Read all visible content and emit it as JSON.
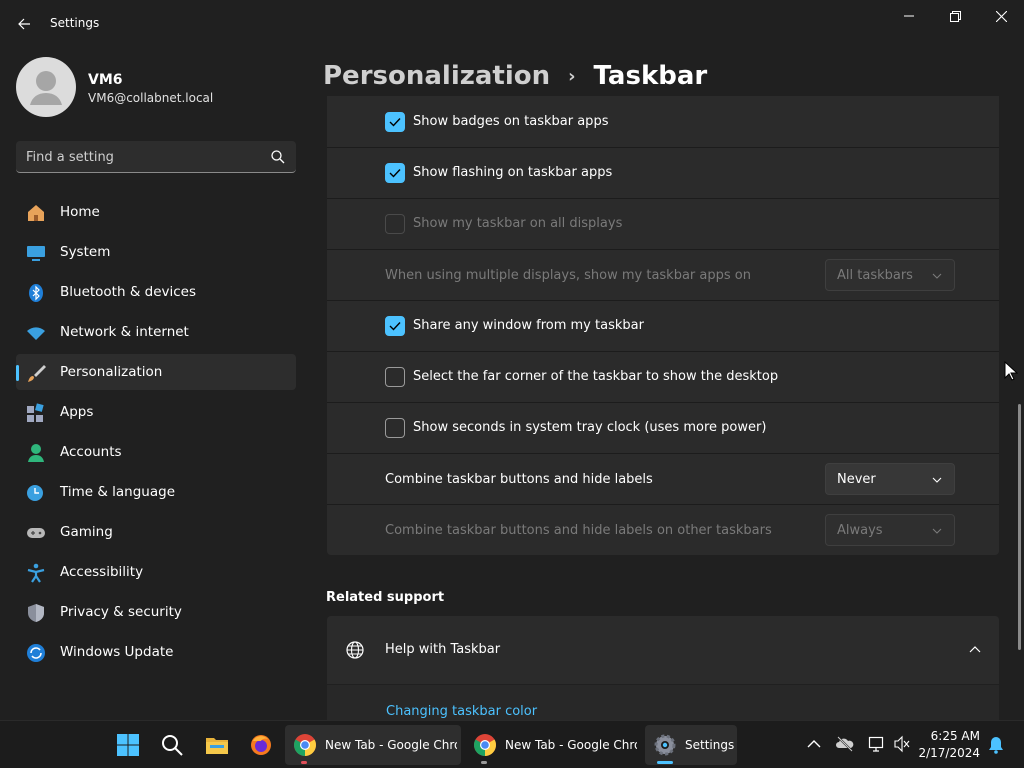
{
  "window": {
    "title": "Settings",
    "controls": [
      "minimize",
      "restore",
      "close"
    ]
  },
  "user": {
    "name": "VM6",
    "email": "VM6@collabnet.local"
  },
  "search": {
    "placeholder": "Find a setting"
  },
  "nav": {
    "items": [
      {
        "label": "Home",
        "icon": "home-icon"
      },
      {
        "label": "System",
        "icon": "system-icon"
      },
      {
        "label": "Bluetooth & devices",
        "icon": "bluetooth-icon"
      },
      {
        "label": "Network & internet",
        "icon": "wifi-icon"
      },
      {
        "label": "Personalization",
        "icon": "brush-icon",
        "selected": true
      },
      {
        "label": "Apps",
        "icon": "apps-icon"
      },
      {
        "label": "Accounts",
        "icon": "accounts-icon"
      },
      {
        "label": "Time & language",
        "icon": "time-language-icon"
      },
      {
        "label": "Gaming",
        "icon": "gaming-icon"
      },
      {
        "label": "Accessibility",
        "icon": "accessibility-icon"
      },
      {
        "label": "Privacy & security",
        "icon": "shield-icon"
      },
      {
        "label": "Windows Update",
        "icon": "windows-update-icon"
      }
    ]
  },
  "header": {
    "parent": "Personalization",
    "separator": "›",
    "current": "Taskbar"
  },
  "settings": [
    {
      "type": "checkbox",
      "label": "Show badges on taskbar apps",
      "checked": true,
      "disabled": false
    },
    {
      "type": "checkbox",
      "label": "Show flashing on taskbar apps",
      "checked": true,
      "disabled": false
    },
    {
      "type": "checkbox",
      "label": "Show my taskbar on all displays",
      "checked": false,
      "disabled": true
    },
    {
      "type": "dropdown",
      "label": "When using multiple displays, show my taskbar apps on",
      "value": "All taskbars",
      "disabled": true
    },
    {
      "type": "checkbox",
      "label": "Share any window from my taskbar",
      "checked": true,
      "disabled": false
    },
    {
      "type": "checkbox",
      "label": "Select the far corner of the taskbar to show the desktop",
      "checked": false,
      "disabled": false
    },
    {
      "type": "checkbox",
      "label": "Show seconds in system tray clock (uses more power)",
      "checked": false,
      "disabled": false
    },
    {
      "type": "dropdown",
      "label": "Combine taskbar buttons and hide labels",
      "value": "Never",
      "disabled": false
    },
    {
      "type": "dropdown",
      "label": "Combine taskbar buttons and hide labels on other taskbars",
      "value": "Always",
      "disabled": true
    }
  ],
  "related": {
    "title": "Related support",
    "help_title": "Help with Taskbar",
    "link": "Changing taskbar color"
  },
  "taskbar": {
    "apps": [
      {
        "label": "New Tab - Google Chrome",
        "icon": "chrome-icon",
        "active": true
      },
      {
        "label": "New Tab - Google Chrome",
        "icon": "chrome-icon",
        "active": false
      },
      {
        "label": "Settings",
        "icon": "settings-gear-icon",
        "active": true
      }
    ],
    "time": "6:25 AM",
    "date": "2/17/2024"
  },
  "colors": {
    "accent": "#4cc2ff",
    "background": "#202020",
    "card": "#2b2b2b"
  }
}
